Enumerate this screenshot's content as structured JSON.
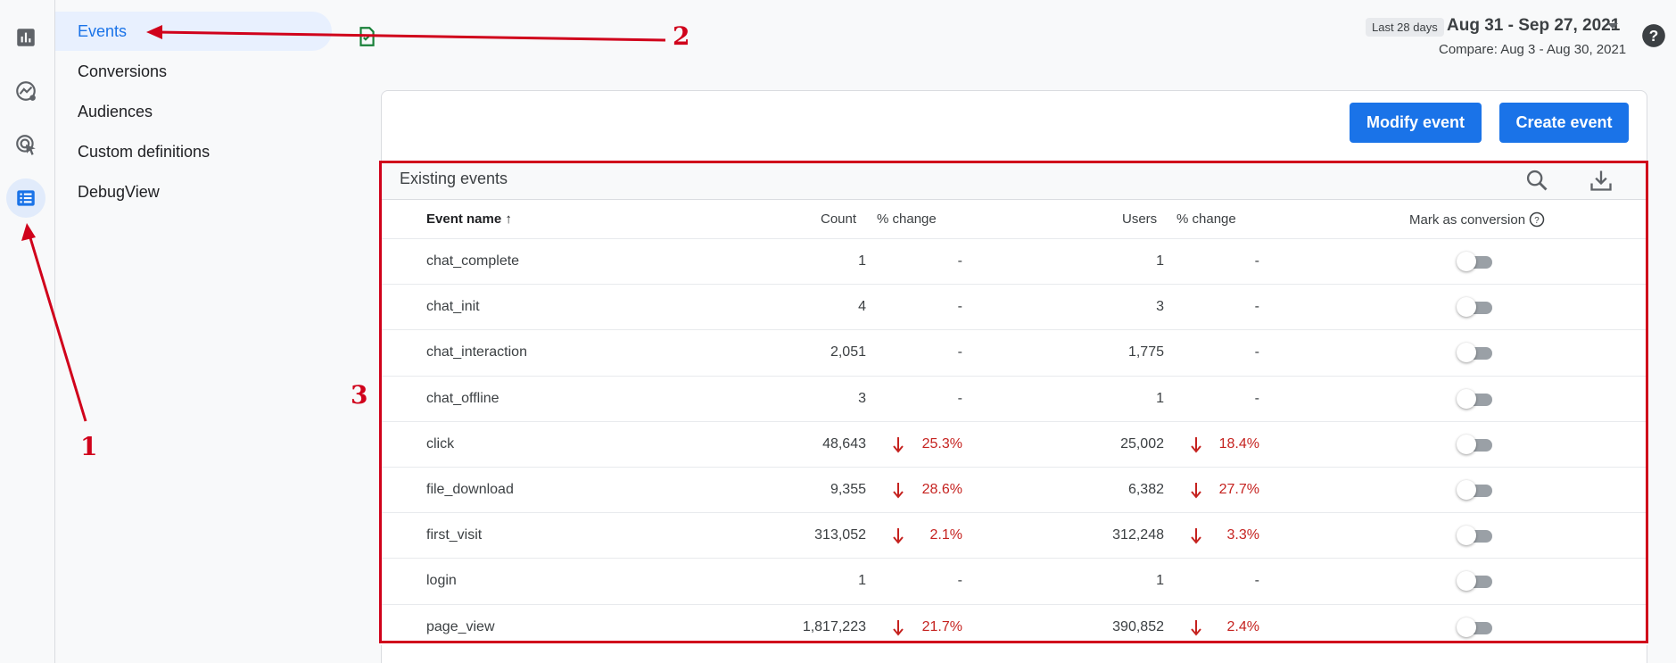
{
  "rail": {
    "items": [
      {
        "icon": "bar-chart-icon"
      },
      {
        "icon": "explore-icon"
      },
      {
        "icon": "advertising-icon"
      },
      {
        "icon": "configure-list-icon",
        "active": true
      }
    ]
  },
  "subnav": {
    "items": [
      {
        "label": "Events",
        "active": true
      },
      {
        "label": "Conversions"
      },
      {
        "label": "Audiences"
      },
      {
        "label": "Custom definitions"
      },
      {
        "label": "DebugView"
      }
    ]
  },
  "header": {
    "date_chip": "Last 28 days",
    "date_range": "Aug 31 - Sep 27, 2021",
    "compare": "Compare: Aug 3 - Aug 30, 2021"
  },
  "actions": {
    "modify": "Modify event",
    "create": "Create event"
  },
  "table": {
    "title": "Existing events",
    "columns": {
      "event_name": "Event name",
      "count": "Count",
      "count_change": "% change",
      "users": "Users",
      "users_change": "% change",
      "mark_conversion": "Mark as conversion"
    },
    "rows": [
      {
        "name": "chat_complete",
        "count": "1",
        "count_change": "-",
        "users": "1",
        "users_change": "-"
      },
      {
        "name": "chat_init",
        "count": "4",
        "count_change": "-",
        "users": "3",
        "users_change": "-"
      },
      {
        "name": "chat_interaction",
        "count": "2,051",
        "count_change": "-",
        "users": "1,775",
        "users_change": "-"
      },
      {
        "name": "chat_offline",
        "count": "3",
        "count_change": "-",
        "users": "1",
        "users_change": "-"
      },
      {
        "name": "click",
        "count": "48,643",
        "count_change": "25.3%",
        "users": "25,002",
        "users_change": "18.4%"
      },
      {
        "name": "file_download",
        "count": "9,355",
        "count_change": "28.6%",
        "users": "6,382",
        "users_change": "27.7%"
      },
      {
        "name": "first_visit",
        "count": "313,052",
        "count_change": "2.1%",
        "users": "312,248",
        "users_change": "3.3%"
      },
      {
        "name": "login",
        "count": "1",
        "count_change": "-",
        "users": "1",
        "users_change": "-"
      },
      {
        "name": "page_view",
        "count": "1,817,223",
        "count_change": "21.7%",
        "users": "390,852",
        "users_change": "2.4%"
      }
    ]
  },
  "annotations": {
    "one": "1",
    "two": "2",
    "three": "3",
    "color": "#d0021b"
  },
  "colors": {
    "accent": "#1a73e8",
    "negative": "#c5221f"
  }
}
